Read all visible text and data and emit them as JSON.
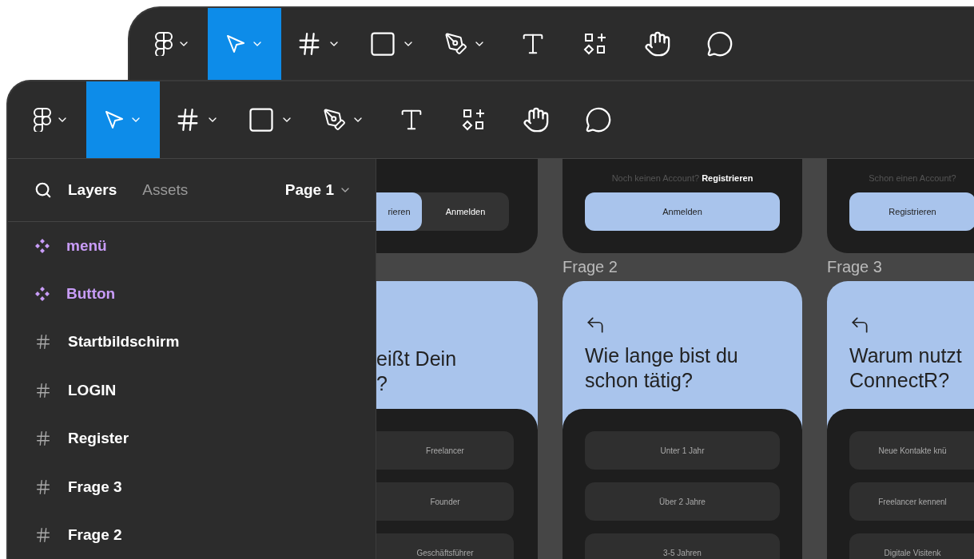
{
  "back_window": {
    "toolbar": [
      {
        "kind": "logo",
        "selected": false,
        "dropdown": true
      },
      {
        "kind": "move",
        "selected": true,
        "dropdown": true
      },
      {
        "kind": "frame",
        "selected": false,
        "dropdown": true
      },
      {
        "kind": "shape",
        "selected": false,
        "dropdown": true
      },
      {
        "kind": "pen",
        "selected": false,
        "dropdown": true
      },
      {
        "kind": "text",
        "selected": false,
        "dropdown": false
      },
      {
        "kind": "resources",
        "selected": false,
        "dropdown": false
      },
      {
        "kind": "hand",
        "selected": false,
        "dropdown": false
      },
      {
        "kind": "comment",
        "selected": false,
        "dropdown": false
      }
    ]
  },
  "window": {
    "toolbar": [
      {
        "kind": "logo",
        "selected": false,
        "dropdown": true
      },
      {
        "kind": "move",
        "selected": true,
        "dropdown": true
      },
      {
        "kind": "frame",
        "selected": false,
        "dropdown": true
      },
      {
        "kind": "shape",
        "selected": false,
        "dropdown": true
      },
      {
        "kind": "pen",
        "selected": false,
        "dropdown": true
      },
      {
        "kind": "text",
        "selected": false,
        "dropdown": false
      },
      {
        "kind": "resources",
        "selected": false,
        "dropdown": false
      },
      {
        "kind": "hand",
        "selected": false,
        "dropdown": false
      },
      {
        "kind": "comment",
        "selected": false,
        "dropdown": false
      }
    ],
    "sidebar": {
      "tabs": [
        {
          "label": "Layers",
          "selected": true
        },
        {
          "label": "Assets",
          "selected": false
        }
      ],
      "page": "Page 1",
      "layers": [
        {
          "kind": "component",
          "label": "menü"
        },
        {
          "kind": "component",
          "label": "Button"
        },
        {
          "kind": "frame",
          "label": "Startbildschirm"
        },
        {
          "kind": "frame",
          "label": "LOGIN"
        },
        {
          "kind": "frame",
          "label": "Register"
        },
        {
          "kind": "frame",
          "label": "Frage 3"
        },
        {
          "kind": "frame",
          "label": "Frage 2"
        }
      ]
    },
    "canvas": {
      "columns": [
        {
          "top_card": {
            "buttons": [
              {
                "label": "rieren",
                "selected": true
              },
              {
                "label": "Anmelden",
                "selected": false
              }
            ]
          },
          "question_card": {
            "back_button": false,
            "lines": [
              "eißt Dein",
              "?"
            ],
            "options": [
              "Freelancer",
              "Founder",
              "Geschäftsführer"
            ]
          }
        },
        {
          "top_card": {
            "prompt": "Noch keinen Account? **Registrieren**",
            "buttons": [
              {
                "label": "Anmelden"
              }
            ]
          },
          "frame_label": "Frage 2",
          "question_card": {
            "back_button": true,
            "lines": [
              "Wie lange bist du",
              "schon tätig?"
            ],
            "options": [
              "Unter 1 Jahr",
              "Über 2 Jahre",
              "3-5 Jahren"
            ]
          }
        },
        {
          "top_card": {
            "prompt": "Schon einen Account?",
            "buttons": [
              {
                "label": "Registrieren"
              }
            ]
          },
          "frame_label": "Frage 3",
          "question_card": {
            "back_button": true,
            "lines": [
              "Warum nutzt",
              "ConnectR?"
            ],
            "options": [
              "Neue Kontakte knü",
              "Freelancer kennenl",
              "Digitale Visitenk"
            ]
          }
        }
      ]
    }
  }
}
